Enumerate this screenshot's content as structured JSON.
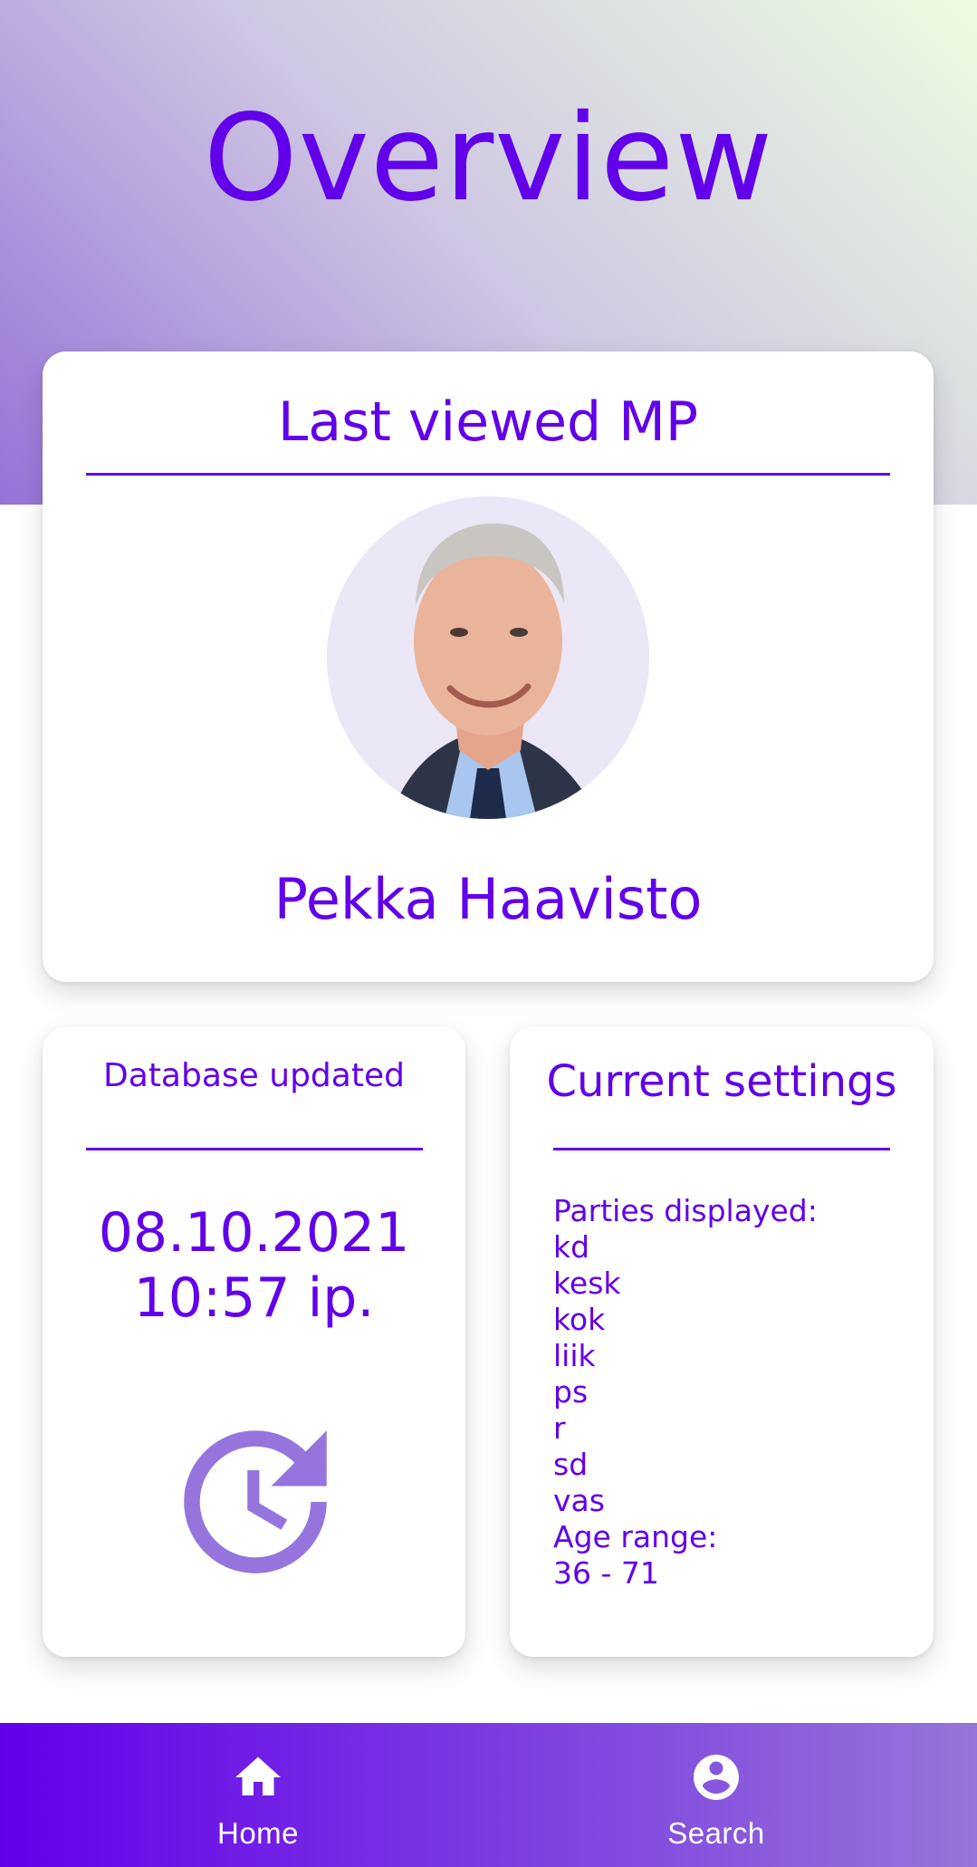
{
  "header": {
    "title": "Overview"
  },
  "last_viewed": {
    "heading": "Last viewed MP",
    "name": "Pekka Haavisto"
  },
  "database": {
    "heading": "Database updated",
    "date": "08.10.2021",
    "time": "10:57 ip.",
    "icon": "update-clock-icon"
  },
  "settings": {
    "heading": "Current settings",
    "parties_label": "Parties displayed:",
    "parties": [
      "kd",
      "kesk",
      "kok",
      "liik",
      "ps",
      "r",
      "sd",
      "vas"
    ],
    "age_label": "Age range:",
    "age_value": "36 - 71"
  },
  "nav": {
    "items": [
      {
        "label": "Home",
        "icon": "home-icon"
      },
      {
        "label": "Search",
        "icon": "account-circle-icon"
      }
    ]
  },
  "colors": {
    "accent": "#6200ea",
    "icon_light": "#9575dd",
    "nav_start": "#6200ea",
    "nav_end": "#9575d8"
  }
}
